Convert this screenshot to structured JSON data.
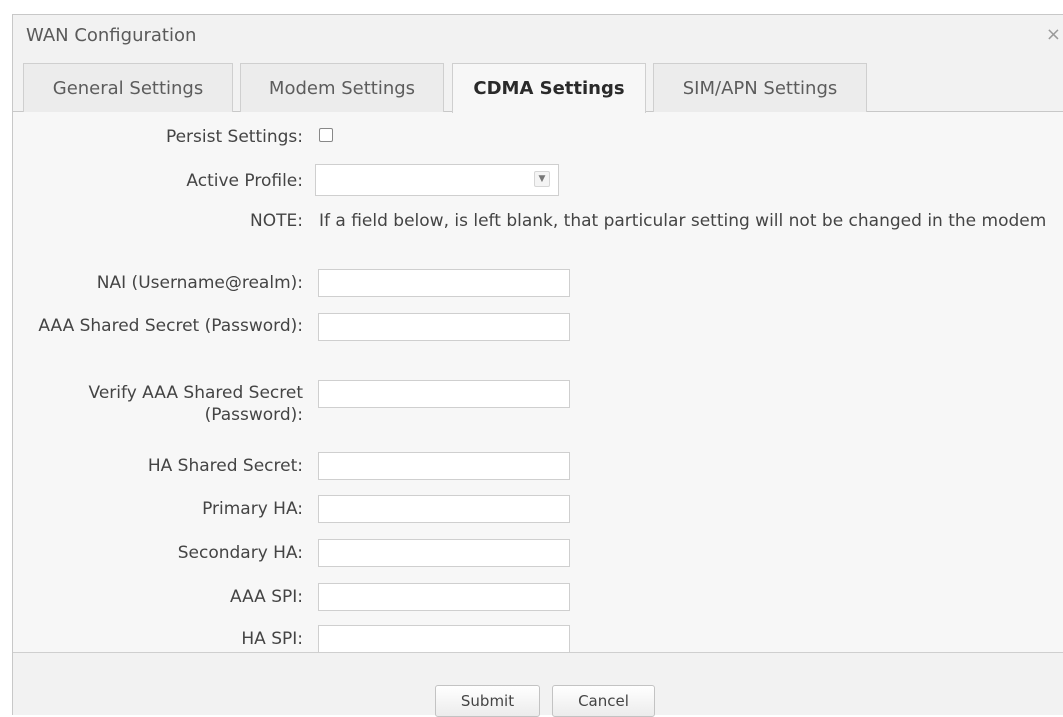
{
  "dialog": {
    "title": "WAN Configuration",
    "close_glyph": "×",
    "tabs": [
      {
        "label": "General Settings",
        "active": false
      },
      {
        "label": "Modem Settings",
        "active": false
      },
      {
        "label": "CDMA Settings",
        "active": true
      },
      {
        "label": "SIM/APN Settings",
        "active": false
      }
    ]
  },
  "form": {
    "persist": {
      "label": "Persist Settings:",
      "checked": false
    },
    "active_profile": {
      "label": "Active Profile:",
      "value": "",
      "arrow_glyph": "▼"
    },
    "note": {
      "label": "NOTE:",
      "text": "If a field below, is left blank, that particular setting will not be changed in the modem"
    },
    "fields": [
      {
        "label": "NAI (Username@realm):",
        "value": ""
      },
      {
        "label": "AAA Shared Secret (Password):",
        "value": ""
      },
      {
        "label": "Verify AAA Shared Secret (Password):",
        "value": ""
      },
      {
        "label": "HA Shared Secret:",
        "value": ""
      },
      {
        "label": "Primary HA:",
        "value": ""
      },
      {
        "label": "Secondary HA:",
        "value": ""
      },
      {
        "label": "AAA SPI:",
        "value": ""
      },
      {
        "label": "HA SPI:",
        "value": ""
      }
    ]
  },
  "footer": {
    "submit_label": "Submit",
    "cancel_label": "Cancel"
  }
}
